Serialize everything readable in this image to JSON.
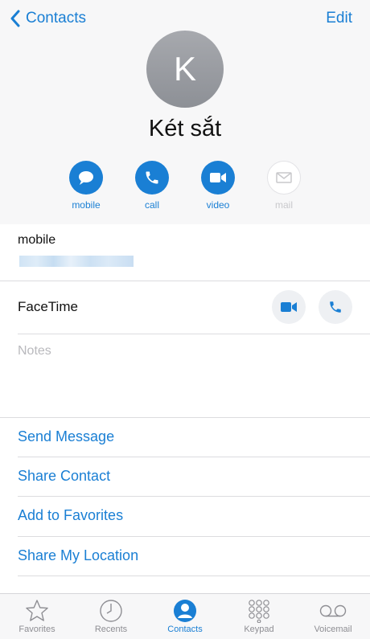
{
  "nav": {
    "back_label": "Contacts",
    "edit_label": "Edit"
  },
  "contact": {
    "initial": "K",
    "name": "Két sắt"
  },
  "actions": [
    {
      "label": "mobile",
      "icon": "message-icon",
      "enabled": true
    },
    {
      "label": "call",
      "icon": "phone-icon",
      "enabled": true
    },
    {
      "label": "video",
      "icon": "video-icon",
      "enabled": true
    },
    {
      "label": "mail",
      "icon": "mail-icon",
      "enabled": false
    }
  ],
  "details": {
    "phone_label": "mobile",
    "facetime_label": "FaceTime",
    "notes_placeholder": "Notes"
  },
  "links": {
    "send_message": "Send Message",
    "share_contact": "Share Contact",
    "add_favorites": "Add to Favorites",
    "share_location": "Share My Location"
  },
  "tabs": [
    {
      "label": "Favorites",
      "icon": "star-icon",
      "active": false
    },
    {
      "label": "Recents",
      "icon": "clock-icon",
      "active": false
    },
    {
      "label": "Contacts",
      "icon": "person-icon",
      "active": true
    },
    {
      "label": "Keypad",
      "icon": "keypad-icon",
      "active": false
    },
    {
      "label": "Voicemail",
      "icon": "voicemail-icon",
      "active": false
    }
  ],
  "colors": {
    "accent": "#1a7fd4",
    "inactive": "#8e8e93",
    "avatar": "#9b9da2"
  }
}
